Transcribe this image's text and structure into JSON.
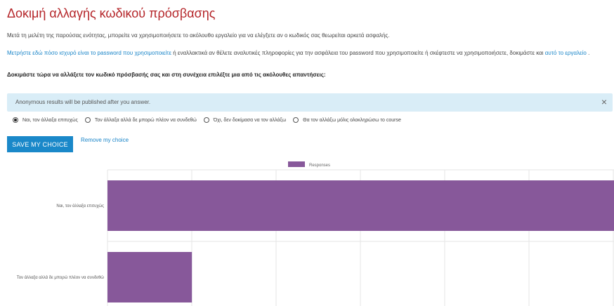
{
  "page": {
    "title": "Δοκιμή αλλαγής κωδικού πρόσβασης",
    "intro": "Μετά τη μελέτη της παρούσας ενότητας, μπορείτε να χρησιμοποιήσετε το ακόλουθο εργαλείο για να ελέγξετε αν ο κωδικός σας θεωρείται αρκετά ασφαλής.",
    "para_link1": "Μετρήστε εδώ πόσο ισχυρό είναι το password που χρησιμοποιείτε",
    "para_mid": " ή εναλλακτικά αν θέλετε αναλυτικές πληροφορίες για την ασφάλεια του password που χρησιμοποιείτε ή σκέφτεστε να χρησιμοποιήσετε, δοκιμάστε και ",
    "para_link2": "αυτό το εργαλείο",
    "para_end": " .",
    "instruction": "Δοκιμάστε τώρα να αλλάξετε τον κωδικό πρόσβασής σας και στη συνέχεια επιλέξτε μια από τις ακόλουθες απαντήσεις:"
  },
  "alert": {
    "text": "Anonymous results will be published after you answer.",
    "close": "×"
  },
  "options": [
    {
      "label": "Ναι, τον άλλαξα επιτυχώς",
      "checked": true
    },
    {
      "label": "Τον άλλαξα αλλά δε μπορώ πλέον να συνδεθώ",
      "checked": false
    },
    {
      "label": "Όχι, δεν δοκίμασα να τον αλλάξω",
      "checked": false
    },
    {
      "label": "Θα τον αλλάξω μόλις ολοκληρώσω το course",
      "checked": false
    }
  ],
  "actions": {
    "save_label": "SAVE MY CHOICE",
    "remove_label": "Remove my choice"
  },
  "chart_data": {
    "type": "bar",
    "orientation": "horizontal",
    "legend": [
      "Responses"
    ],
    "legend_position": "top",
    "categories": [
      "Ναι, τον άλλαξα επιτυχώς",
      "Τον άλλαξα αλλά δε μπορώ πλέον να συνδεθώ"
    ],
    "series": [
      {
        "name": "Responses",
        "values": [
          6,
          1
        ],
        "color": "#87589a"
      }
    ],
    "xlim": [
      0,
      6
    ],
    "grid": true
  }
}
